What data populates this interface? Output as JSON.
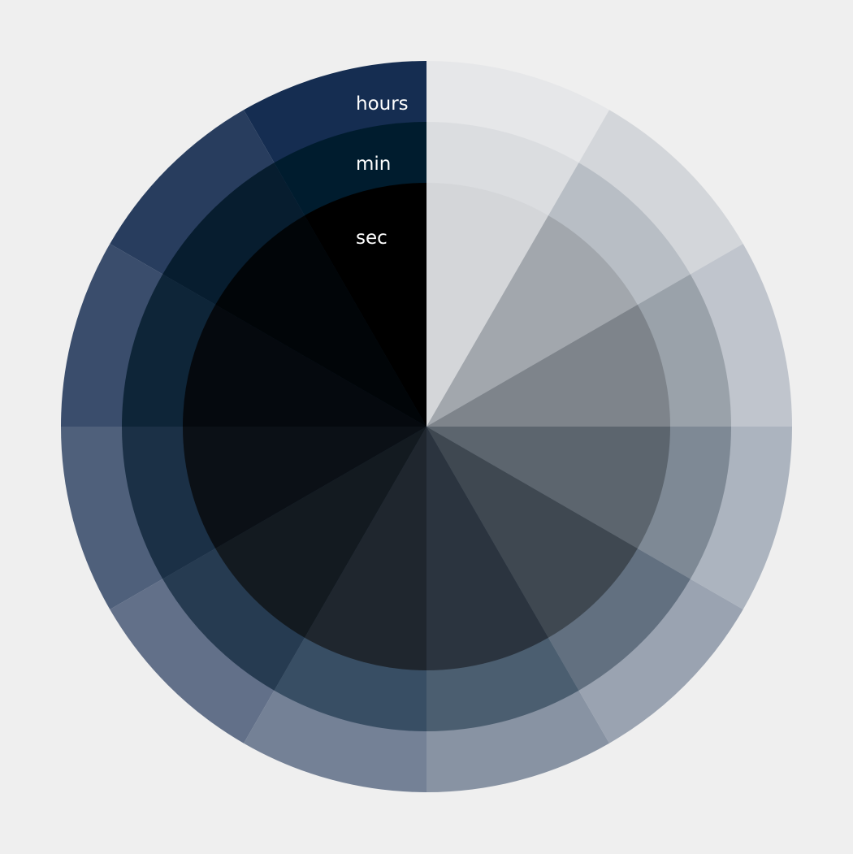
{
  "clock": {
    "labels": {
      "hours": "hours",
      "minutes": "min",
      "seconds": "sec"
    },
    "background": "#efefef",
    "segments_per_ring": 12,
    "rings": {
      "hours": {
        "colors": [
          "#e6e7e9",
          "#d3d6da",
          "#c0c5cd",
          "#acb4bf",
          "#9aa3b1",
          "#8893a3",
          "#748196",
          "#627089",
          "#4f607b",
          "#3a4d6c",
          "#283d5e",
          "#152d51"
        ]
      },
      "minutes": {
        "colors": [
          "#dbdde0",
          "#b8bec5",
          "#9aa2aa",
          "#7e8995",
          "#627080",
          "#4b5e70",
          "#384e64",
          "#263b51",
          "#1b3046",
          "#0e2538",
          "#071d2f",
          "#001c2e"
        ]
      },
      "seconds": {
        "colors": [
          "#d4d6d9",
          "#a2a7ad",
          "#7e848b",
          "#5c656e",
          "#3f4851",
          "#2b343f",
          "#1f262e",
          "#131a20",
          "#0b1016",
          "#05090e",
          "#010508",
          "#000000"
        ]
      }
    }
  }
}
